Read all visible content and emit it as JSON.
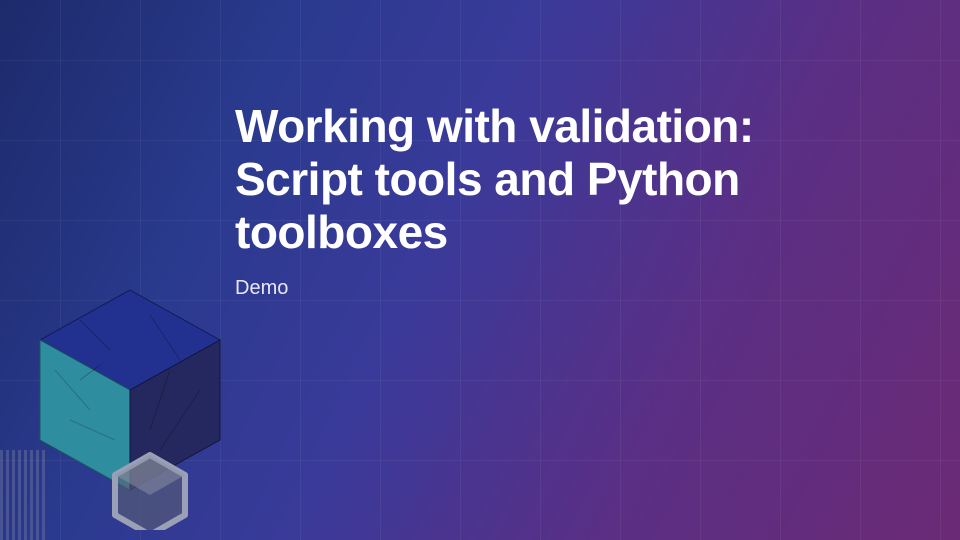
{
  "slide": {
    "title": "Working with validation: Script tools and Python toolboxes",
    "subtitle": "Demo"
  },
  "graphic": {
    "name": "cube-icon"
  },
  "colors": {
    "bg_start": "#1d2a6b",
    "bg_end": "#6b2a75",
    "cube_top": "#1f3aa0",
    "cube_left": "#3a8b9a",
    "cube_right": "#2a2f6b",
    "small_hex": "#5a5f75"
  }
}
